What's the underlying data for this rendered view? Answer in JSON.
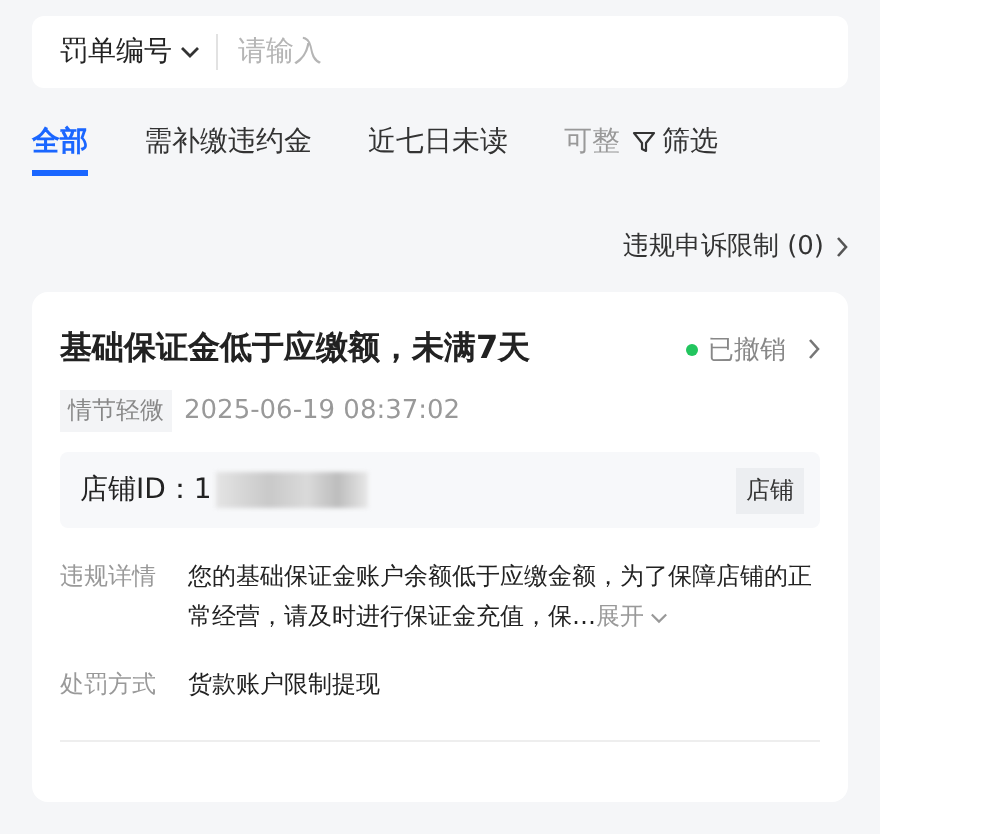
{
  "search": {
    "field_selector": "罚单编号",
    "placeholder": "请输入"
  },
  "tabs": [
    {
      "label": "全部",
      "selected": true
    },
    {
      "label": "需补缴违约金",
      "selected": false
    },
    {
      "label": "近七日未读",
      "selected": false
    },
    {
      "label": "可整",
      "selected": false
    }
  ],
  "filter": {
    "label": "筛选"
  },
  "appeal_link": "违规申诉限制 (0)",
  "card": {
    "title": "基础保证金低于应缴额，未满7天",
    "status": {
      "label": "已撤销",
      "color": "#22c55e"
    },
    "severity_tag": "情节轻微",
    "time": "2025-06-19 08:37:02",
    "store": {
      "label": "店铺ID：1",
      "tag": "店铺"
    },
    "details": [
      {
        "label": "违规详情",
        "text": "您的基础保证金账户余额低于应缴金额，为了保障店铺的正常经营，请及时进行保证金充值，保…",
        "expand": "展开"
      },
      {
        "label": "处罚方式",
        "text": "货款账户限制提现"
      }
    ]
  }
}
